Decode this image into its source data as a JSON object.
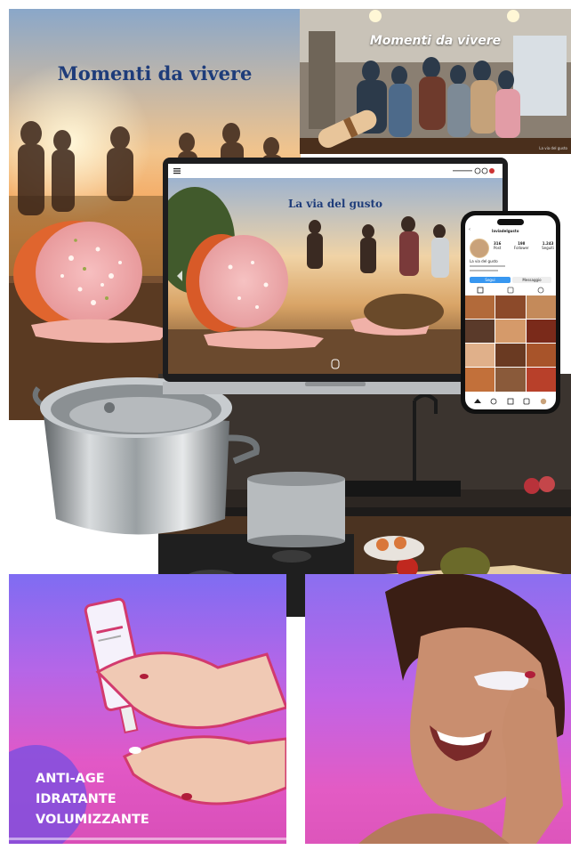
{
  "collage": {
    "panel_sunset": {
      "title": "Momenti da vivere"
    },
    "panel_indoor": {
      "title": "Momenti da vivere",
      "credit": "La via del gusto"
    },
    "laptop": {
      "hero_title": "La via del gusto",
      "menu_icon": "hamburger-menu-icon",
      "flag_icons": [
        "circle-icon",
        "circle-icon",
        "flag-icon"
      ]
    },
    "phone": {
      "profile_name": "laviadelgusto",
      "stats": [
        {
          "value": "316",
          "label": "Post"
        },
        {
          "value": "198",
          "label": "Follower"
        },
        {
          "value": "1.243",
          "label": "Seguiti"
        }
      ],
      "bio_name": "La via del gusto",
      "follow_label": "Segui",
      "message_label": "Messaggio"
    },
    "cosmetics": {
      "lines": [
        "ANTI-AGE",
        "IDRATANTE",
        "VOLUMIZZANTE"
      ]
    },
    "colors": {
      "title_blue": "#1e3c7a",
      "cosmetic_purple": "#b466e8",
      "cosmetic_pink": "#e258c6"
    }
  }
}
